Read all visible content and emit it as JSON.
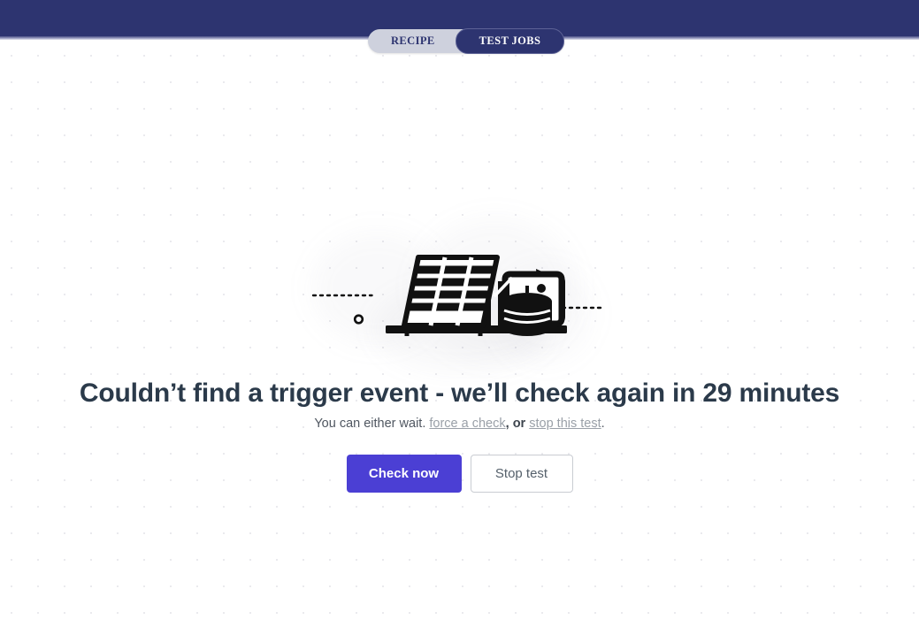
{
  "header": {
    "bar_color": "#2d3470",
    "tabs": [
      {
        "label": "RECIPE",
        "active": false
      },
      {
        "label": "TEST JOBS",
        "active": true
      }
    ]
  },
  "illustration": {
    "name": "data-table-chart-database-illustration",
    "accent_color": "#111111",
    "decorations": [
      "dashed-line-left",
      "small-ring",
      "dashed-line-right",
      "triangle-marker"
    ]
  },
  "main": {
    "headline": "Couldn’t find a trigger event - we’ll check again in 29 minutes",
    "subtitle": {
      "prefix": "You can either wait.",
      "link_force_check": "force a check",
      "middle": ", or",
      "link_stop_test": "stop this test",
      "suffix": "."
    },
    "buttons": {
      "primary": {
        "label": "Check now",
        "color": "#4b3fd4",
        "text_color": "#ffffff"
      },
      "secondary": {
        "label": "Stop test",
        "color": "#ffffff",
        "text_color": "#55606b"
      }
    }
  }
}
